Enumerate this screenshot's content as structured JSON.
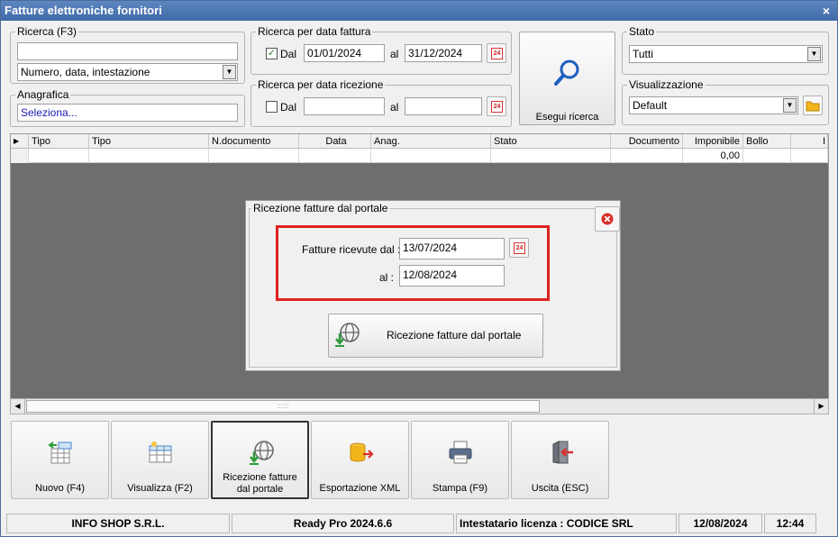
{
  "window": {
    "title": "Fatture elettroniche fornitori",
    "close": "×"
  },
  "ricerca": {
    "legend": "Ricerca (F3)",
    "query": "",
    "mode": "Numero, data, intestazione"
  },
  "anagrafica": {
    "legend": "Anagrafica",
    "value": "Seleziona..."
  },
  "data_fattura": {
    "legend": "Ricerca per data fattura",
    "dal_label": "Dal",
    "al_label": "al",
    "from": "01/01/2024",
    "to": "31/12/2024",
    "checked": "✓"
  },
  "data_ricezione": {
    "legend": "Ricerca per data ricezione",
    "dal_label": "Dal",
    "al_label": "al",
    "from": "",
    "to": ""
  },
  "search_button": {
    "label": "Esegui ricerca"
  },
  "stato": {
    "legend": "Stato",
    "value": "Tutti"
  },
  "visualizzazione": {
    "legend": "Visualizzazione",
    "value": "Default"
  },
  "calendar_icon_text": "24",
  "table": {
    "columns": [
      "Tipo",
      "Tipo",
      "N.documento",
      "Data",
      "Anag.",
      "Stato",
      "Documento",
      "Imponibile",
      "Bollo",
      "I"
    ],
    "row": {
      "imponibile": "0,00"
    }
  },
  "dialog": {
    "title": "Ricezione fatture dal portale",
    "from_label": "Fatture ricevute dal :",
    "from_value": "13/07/2024",
    "to_label": "al :",
    "to_value": "12/08/2024",
    "button": "Ricezione fatture dal portale"
  },
  "toolbar": {
    "nuovo": "Nuovo (F4)",
    "visualizza": "Visualizza (F2)",
    "ricezione": "Ricezione fatture dal portale",
    "esportazione": "Esportazione XML",
    "stampa": "Stampa (F9)",
    "uscita": "Uscita (ESC)"
  },
  "statusbar": {
    "company": "INFO SHOP S.R.L.",
    "version": "Ready Pro 2024.6.6",
    "license": "Intestatario licenza : CODICE SRL",
    "date": "12/08/2024",
    "time": "12:44"
  },
  "colors": {
    "title_bar": "#3e6aa6",
    "highlight": "#e02020",
    "grid_bg": "#6e6e6e"
  },
  "icons": [
    "search-icon",
    "calendar-icon",
    "folder-icon",
    "close-icon",
    "download-globe-icon",
    "new-document-icon",
    "view-table-icon",
    "export-xml-icon",
    "printer-icon",
    "exit-icon"
  ]
}
